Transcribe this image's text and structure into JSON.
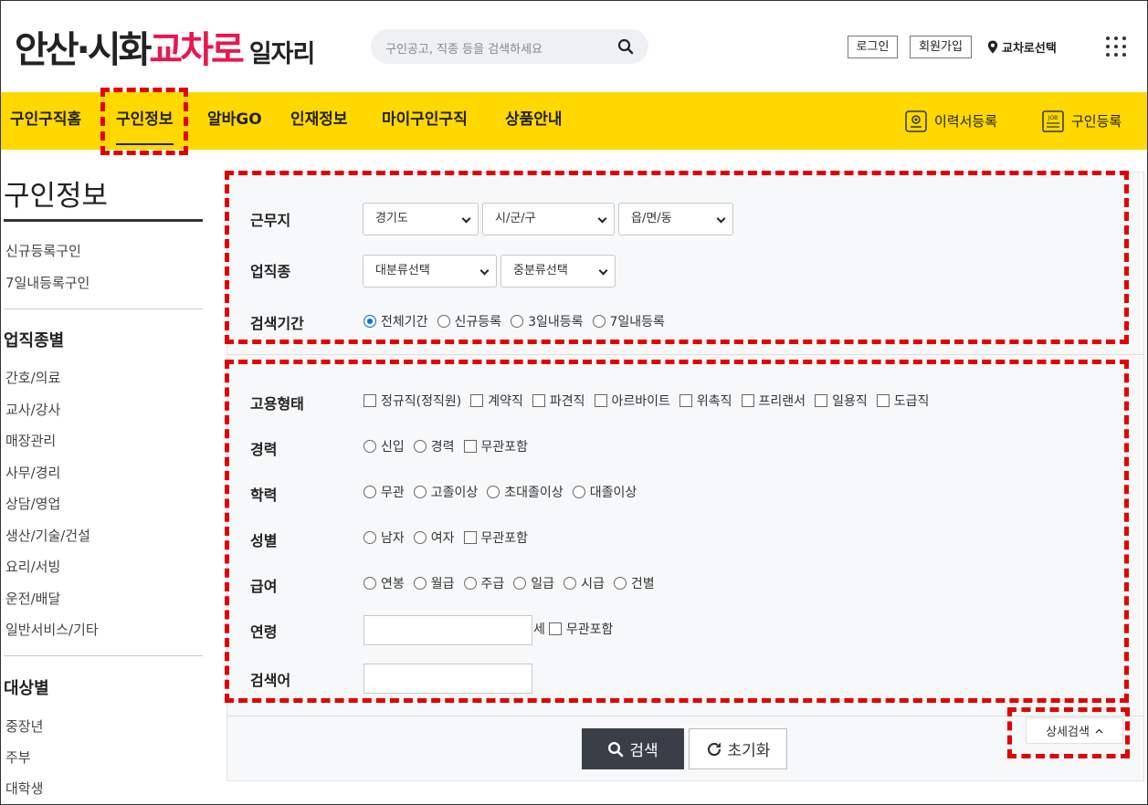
{
  "header": {
    "logo_part1": "안산·시화",
    "logo_part2": "교차로",
    "logo_part3": "일자리",
    "search_placeholder": "구인공고, 직종 등을 검색하세요",
    "login": "로그인",
    "signup": "회원가입",
    "region_select": "교차로선택"
  },
  "nav": {
    "items": [
      "구인구직홈",
      "구인정보",
      "알바GO",
      "인재정보",
      "마이구인구직",
      "상품안내"
    ],
    "active": "구인정보",
    "resume_register": "이력서등록",
    "job_register": "구인등록",
    "job_icon_text": "JOB"
  },
  "sidebar": {
    "title": "구인정보",
    "links_top": [
      "신규등록구인",
      "7일내등록구인"
    ],
    "section1_title": "업직종별",
    "section1_items": [
      "간호/의료",
      "교사/강사",
      "매장관리",
      "사무/경리",
      "상담/영업",
      "생산/기술/건설",
      "요리/서빙",
      "운전/배달",
      "일반서비스/기타"
    ],
    "section2_title": "대상별",
    "section2_items": [
      "중장년",
      "주부",
      "대학생"
    ]
  },
  "filters": {
    "location_label": "근무지",
    "location_selects": [
      "경기도",
      "시/군/구",
      "읍/면/동"
    ],
    "industry_label": "업직종",
    "industry_selects": [
      "대분류선택",
      "중분류선택"
    ],
    "period_label": "검색기간",
    "period_options": [
      "전체기간",
      "신규등록",
      "3일내등록",
      "7일내등록"
    ],
    "period_selected": "전체기간",
    "employment_label": "고용형태",
    "employment_options": [
      "정규직(정직원)",
      "계약직",
      "파견직",
      "아르바이트",
      "위촉직",
      "프리랜서",
      "일용직",
      "도급직"
    ],
    "career_label": "경력",
    "career_radio": [
      "신입",
      "경력"
    ],
    "career_checkbox": "무관포함",
    "education_label": "학력",
    "education_options": [
      "무관",
      "고졸이상",
      "초대졸이상",
      "대졸이상"
    ],
    "gender_label": "성별",
    "gender_radio": [
      "남자",
      "여자"
    ],
    "gender_checkbox": "무관포함",
    "salary_label": "급여",
    "salary_options": [
      "연봉",
      "월급",
      "주급",
      "일급",
      "시급",
      "건별"
    ],
    "age_label": "연령",
    "age_value": "",
    "age_unit": "세",
    "age_checkbox": "무관포함",
    "keyword_label": "검색어",
    "keyword_value": ""
  },
  "actions": {
    "search": "검색",
    "reset": "초기화",
    "detail_search": "상세검색"
  },
  "colors": {
    "nav_background": "#ffd800",
    "logo_accent": "#e8184f",
    "highlight": "#e30000",
    "search_button": "#3a3f47",
    "radio_selected": "#0b6fe5"
  }
}
